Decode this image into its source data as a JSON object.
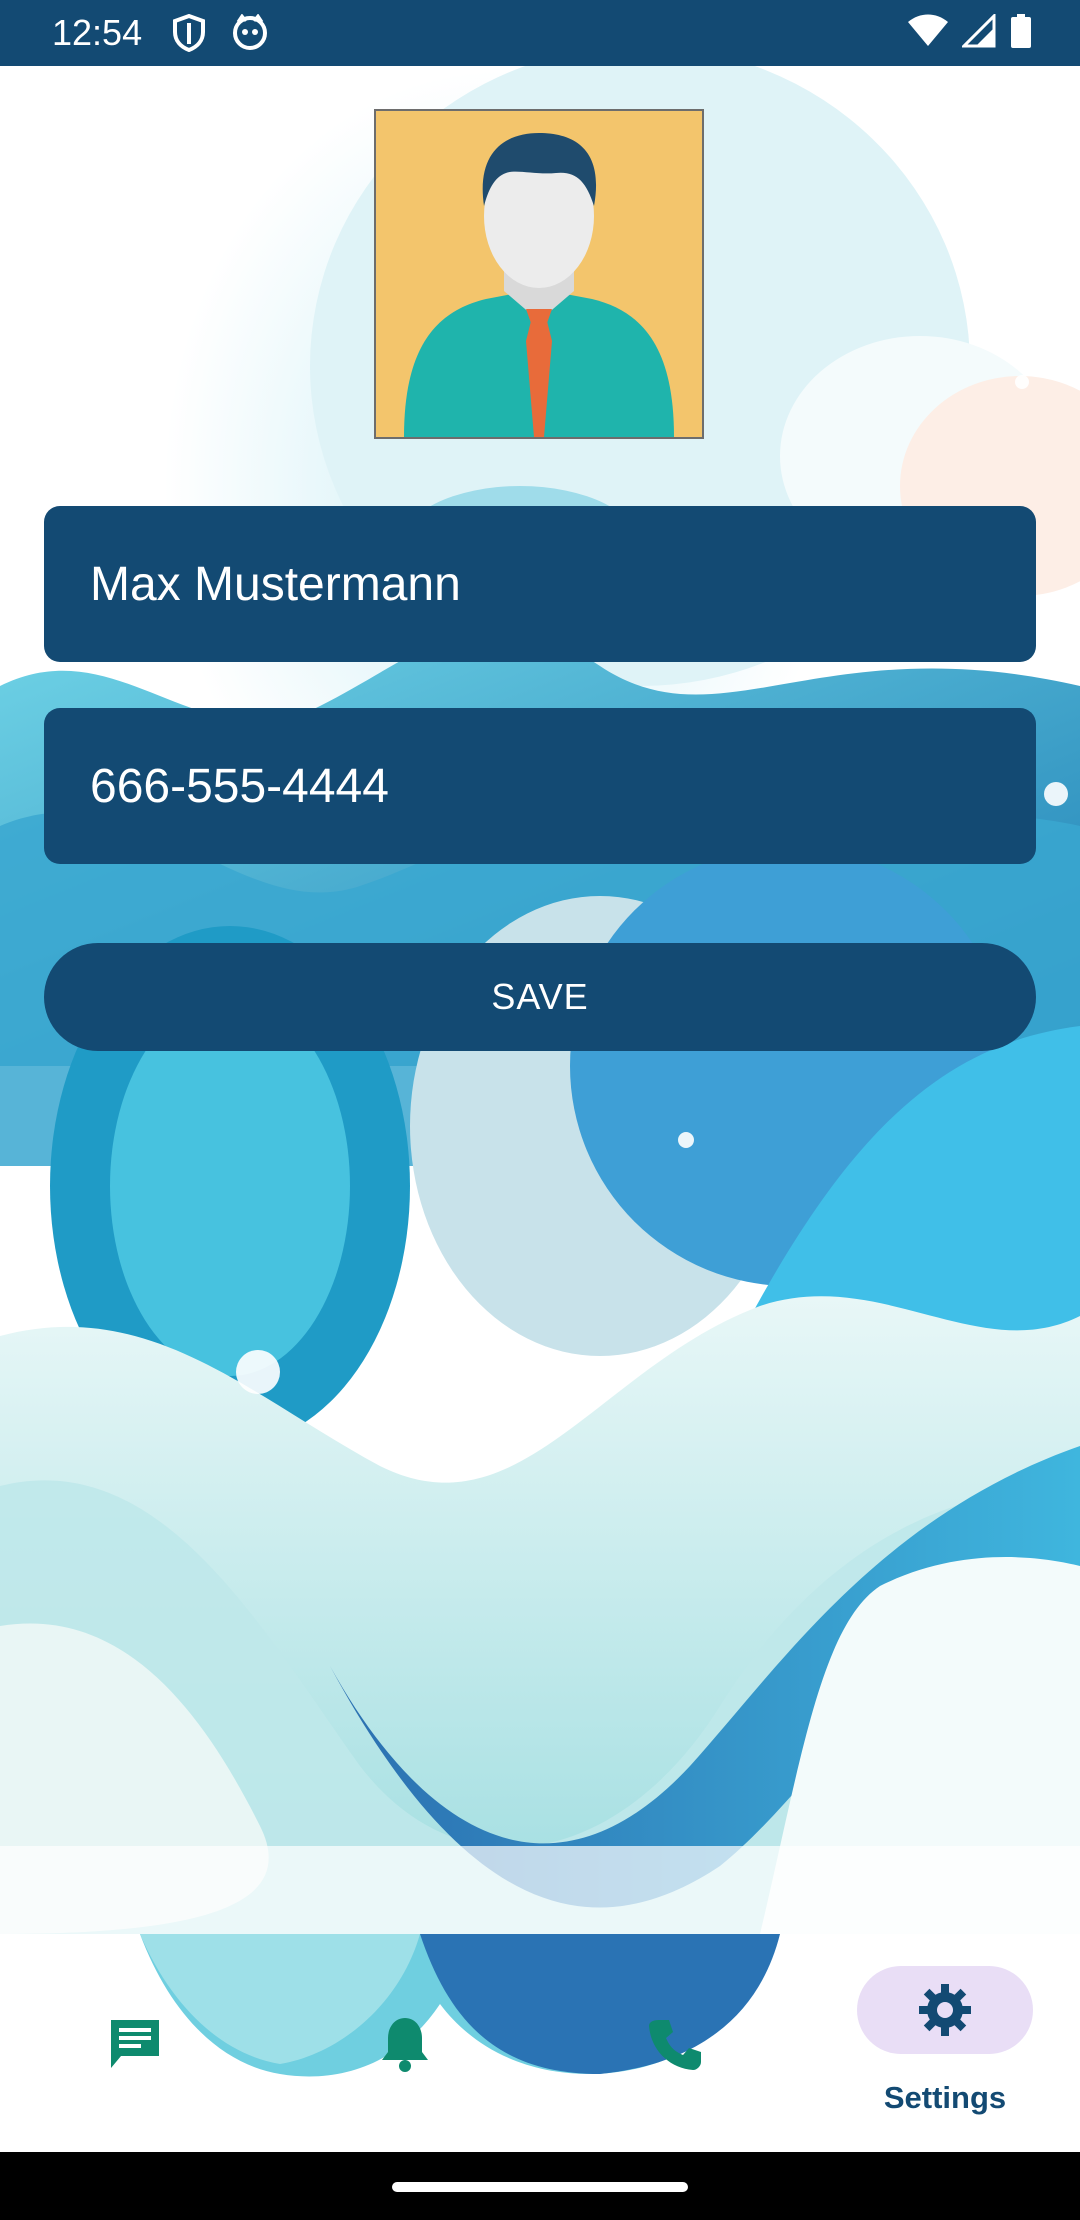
{
  "status_bar": {
    "time": "12:54",
    "left_icons": [
      "shield-icon",
      "cat-icon"
    ],
    "right_icons": [
      "wifi-icon",
      "signal-icon",
      "battery-icon"
    ]
  },
  "profile": {
    "avatar_icon": "user-avatar",
    "name_value": "Max Mustermann",
    "phone_value": "666-555-4444",
    "save_label": "SAVE"
  },
  "bottom_nav": {
    "items": [
      {
        "icon": "chat-icon",
        "label": ""
      },
      {
        "icon": "bell-icon",
        "label": ""
      },
      {
        "icon": "phone-icon",
        "label": ""
      },
      {
        "icon": "gear-icon",
        "label": "Settings",
        "selected": true
      }
    ]
  },
  "colors": {
    "primary": "#134a73",
    "accent_green": "#0e8a6e",
    "selected_pill": "#e9def6",
    "avatar_bg": "#f3c56c"
  }
}
